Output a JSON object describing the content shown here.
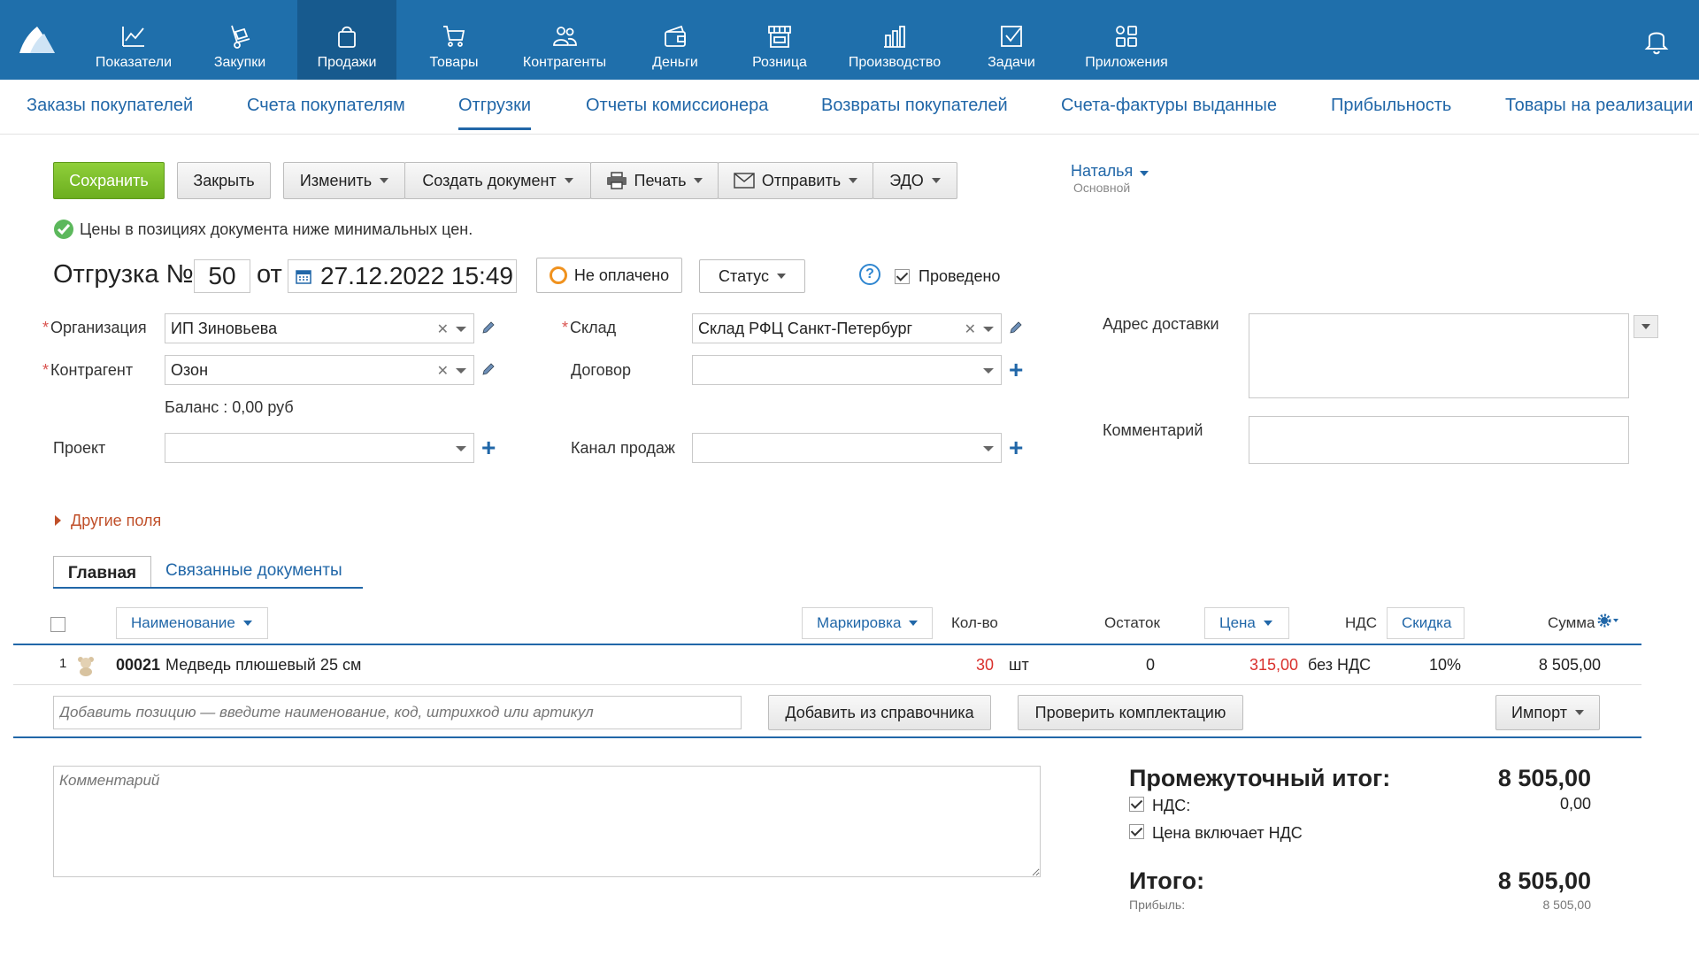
{
  "nav": {
    "items": [
      {
        "label": "Показатели",
        "icon": "chart-line-icon"
      },
      {
        "label": "Закупки",
        "icon": "dolly-icon"
      },
      {
        "label": "Продажи",
        "icon": "shopping-bag-icon",
        "active": true
      },
      {
        "label": "Товары",
        "icon": "cart-icon"
      },
      {
        "label": "Контрагенты",
        "icon": "people-icon"
      },
      {
        "label": "Деньги",
        "icon": "wallet-icon"
      },
      {
        "label": "Розница",
        "icon": "store-icon"
      },
      {
        "label": "Производство",
        "icon": "factory-icon"
      },
      {
        "label": "Задачи",
        "icon": "checkbox-icon"
      },
      {
        "label": "Приложения",
        "icon": "apps-icon"
      }
    ],
    "accent": "#1f6fab"
  },
  "subnav": {
    "tabs": [
      "Заказы покупателей",
      "Счета покупателям",
      "Отгрузки",
      "Отчеты комиссионера",
      "Возвраты покупателей",
      "Счета-фактуры выданные",
      "Прибыльность",
      "Товары на реализации"
    ],
    "active": "Отгрузки"
  },
  "toolbar": {
    "save": "Сохранить",
    "close": "Закрыть",
    "edit": "Изменить",
    "create_doc": "Создать документ",
    "print": "Печать",
    "send": "Отправить",
    "edo": "ЭДО"
  },
  "user": {
    "name": "Наталья",
    "role": "Основной"
  },
  "notice": "Цены в позициях документа ниже минимальных цен.",
  "doc": {
    "title": "Отгрузка №",
    "number": "50",
    "from": "от",
    "date": "27.12.2022 15:49",
    "payment_status": "Не оплачено",
    "status_button": "Статус",
    "posted_label": "Проведено",
    "posted": true
  },
  "form": {
    "org_label": "Организация",
    "org_value": "ИП Зиновьева",
    "contractor_label": "Контрагент",
    "contractor_value": "Озон",
    "balance": "Баланс : 0,00 руб",
    "project_label": "Проект",
    "warehouse_label": "Склад",
    "warehouse_value": "Склад РФЦ Санкт-Петербург",
    "contract_label": "Договор",
    "channel_label": "Канал продаж",
    "address_label": "Адрес доставки",
    "comment_label": "Комментарий",
    "other_fields": "Другие поля"
  },
  "tabs": {
    "main": "Главная",
    "linked": "Связанные документы"
  },
  "table": {
    "headers": {
      "name": "Наименование",
      "marking": "Маркировка",
      "qty": "Кол-во",
      "stock": "Остаток",
      "price": "Цена",
      "vat": "НДС",
      "discount": "Скидка",
      "sum": "Сумма"
    },
    "rows": [
      {
        "n": "1",
        "code": "00021",
        "name": "Медведь плюшевый 25 см",
        "qty": "30",
        "unit": "шт",
        "stock": "0",
        "price": "315,00",
        "vat": "без НДС",
        "discount": "10%",
        "sum": "8 505,00"
      }
    ],
    "add_placeholder": "Добавить позицию — введите наименование, код, штрихкод или артикул",
    "add_from_ref": "Добавить из справочника",
    "check_kit": "Проверить комплектацию",
    "import": "Импорт"
  },
  "comment_placeholder": "Комментарий",
  "totals": {
    "subtotal_label": "Промежуточный итог:",
    "subtotal_value": "8 505,00",
    "vat_label": "НДС:",
    "vat_value": "0,00",
    "price_incl_vat": "Цена включает НДС",
    "total_label": "Итого:",
    "total_value": "8 505,00",
    "profit_label": "Прибыль:",
    "profit_value": "8 505,00"
  }
}
